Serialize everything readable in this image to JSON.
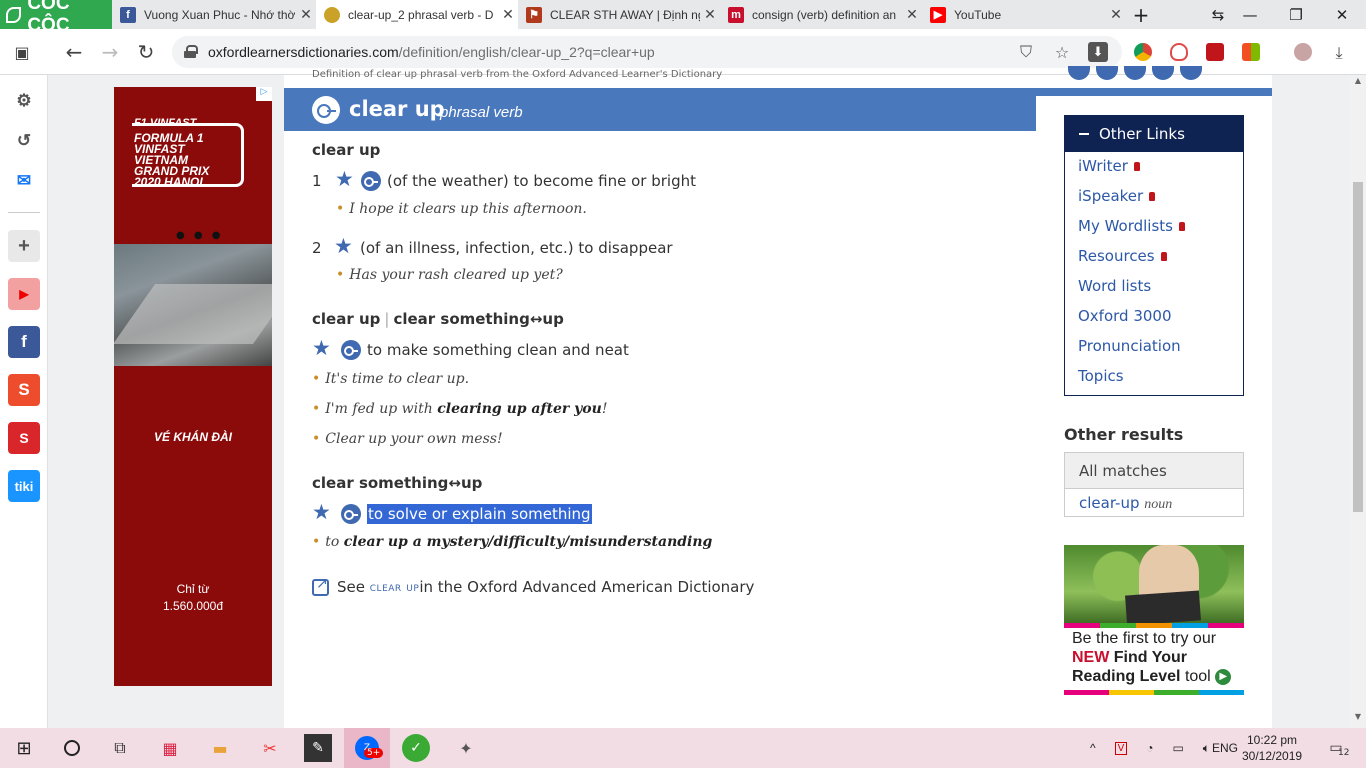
{
  "browser": {
    "brand": "CÔC CÔC",
    "tabs": [
      {
        "title": "Vuong Xuan Phuc - Nhớ thờ",
        "icon": "facebook-icon",
        "color": "#3b5998"
      },
      {
        "title": "clear-up_2 phrasal verb - D",
        "icon": "oxford-icon",
        "color": "#c9a227"
      },
      {
        "title": "CLEAR STH AWAY | Định ng",
        "icon": "cambridge-icon",
        "color": "#b23a1c"
      },
      {
        "title": "consign (verb) definition an",
        "icon": "macmillan-icon",
        "color": "#c8102e"
      },
      {
        "title": "YouTube",
        "icon": "youtube-icon",
        "color": "#ff0000"
      }
    ],
    "url_host": "oxfordlearnersdictionaries.com",
    "url_path": "/definition/english/clear-up_2?q=clear+up"
  },
  "sidebar": {
    "items": [
      {
        "name": "settings-icon",
        "glyph": "⚙"
      },
      {
        "name": "history-icon",
        "glyph": "↺"
      },
      {
        "name": "messenger-icon",
        "glyph": "✉"
      },
      {
        "name": "add-icon",
        "glyph": "+"
      },
      {
        "name": "youtube-icon",
        "glyph": "▶"
      },
      {
        "name": "facebook-icon",
        "glyph": "f"
      },
      {
        "name": "shopee-icon",
        "glyph": "S"
      },
      {
        "name": "sendo-icon",
        "glyph": "S"
      },
      {
        "name": "tiki-icon",
        "glyph": "tiki"
      }
    ]
  },
  "ad": {
    "f1": "F1 VINFAST",
    "title": "FORMULA 1\nVINFAST\nVIETNAM\nGRAND PRIX\n2020 HANOI",
    "dots": "● ● ●",
    "cta": "VÉ KHÁN ĐÀI",
    "price": "Chỉ từ\n1.560.000đ",
    "choice": "▷"
  },
  "page": {
    "crumb": "Definition of clear up phrasal verb from the Oxford Advanced Learner's Dictionary",
    "headword": "clear up",
    "pos": "phrasal verb",
    "pv1": "clear up",
    "senses1": [
      {
        "num": "1",
        "def": "(of the weather) to become fine or bright",
        "example": "I hope it clears up this afternoon."
      },
      {
        "num": "2",
        "def": "(of an illness, infection, etc.) to disappear",
        "example": "Has your rash cleared up yet?"
      }
    ],
    "pv2a": "clear up",
    "pv2sep": "|",
    "pv2b": "clear something↔up",
    "def2": "to make something clean and neat",
    "ex2a": "It's time to clear up.",
    "ex2b_pre": "I'm fed up with ",
    "ex2b_bold": "clearing up after you",
    "ex2b_post": "!",
    "ex2c": "Clear up your own mess!",
    "pv3": "clear something↔up",
    "def3": "to solve or explain something",
    "ex3_pre": "to ",
    "ex3_bold": "clear up a mystery/difficulty/misunderstanding",
    "see_pre": "See ",
    "see_link": "clear up",
    "see_post": " in the Oxford Advanced American Dictionary"
  },
  "other_links": {
    "title": "Other Links",
    "items": [
      "iWriter",
      "iSpeaker",
      "My Wordlists",
      "Resources",
      "Word lists",
      "Oxford 3000",
      "Pronunciation",
      "Topics"
    ]
  },
  "other_results": {
    "title": "Other results",
    "all_matches": "All matches",
    "item_word": "clear-up",
    "item_pos": "noun"
  },
  "promo": {
    "line1": "Be the first to try our",
    "new": "NEW",
    "line2": "Find Your",
    "line3_bold": "Reading Level",
    "line3_rest": "tool"
  },
  "taskbar": {
    "lang": "ENG",
    "time": "10:22 pm",
    "date": "30/12/2019",
    "notif": "12",
    "zalo_badge": "5+"
  }
}
